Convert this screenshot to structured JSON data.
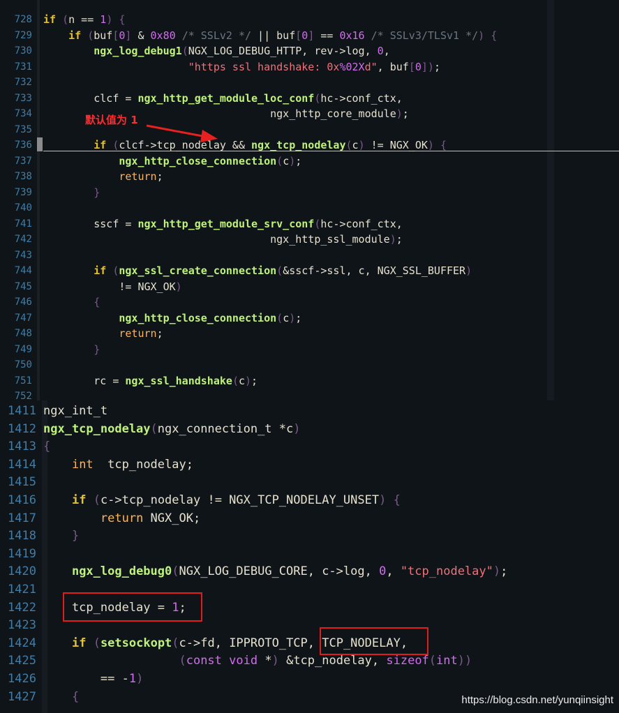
{
  "panel_top": {
    "lines": [
      {
        "n": "728",
        "segs": [
          [
            "t-kw",
            "if"
          ],
          [
            "t-pl",
            " "
          ],
          [
            "t-br",
            "("
          ],
          [
            "t-pl",
            "n == "
          ],
          [
            "t-num",
            "1"
          ],
          [
            "t-br",
            ")"
          ],
          [
            "t-pl",
            " "
          ],
          [
            "t-br",
            "{"
          ]
        ]
      },
      {
        "n": "729",
        "segs": [
          [
            "t-pl",
            "    "
          ],
          [
            "t-kw",
            "if"
          ],
          [
            "t-pl",
            " "
          ],
          [
            "t-br",
            "("
          ],
          [
            "t-pl",
            "buf"
          ],
          [
            "t-br",
            "["
          ],
          [
            "t-num",
            "0"
          ],
          [
            "t-br",
            "]"
          ],
          [
            "t-pl",
            " & "
          ],
          [
            "t-num",
            "0x80"
          ],
          [
            "t-pl",
            " "
          ],
          [
            "t-cm",
            "/* SSLv2 */"
          ],
          [
            "t-pl",
            " || buf"
          ],
          [
            "t-br",
            "["
          ],
          [
            "t-num",
            "0"
          ],
          [
            "t-br",
            "]"
          ],
          [
            "t-pl",
            " == "
          ],
          [
            "t-num",
            "0x16"
          ],
          [
            "t-pl",
            " "
          ],
          [
            "t-cm",
            "/* SSLv3/TLSv1 */"
          ],
          [
            "t-br",
            ")"
          ],
          [
            "t-pl",
            " "
          ],
          [
            "t-br",
            "{"
          ]
        ]
      },
      {
        "n": "730",
        "segs": [
          [
            "t-pl",
            "        "
          ],
          [
            "t-fn",
            "ngx_log_debug1"
          ],
          [
            "t-br",
            "("
          ],
          [
            "t-pl",
            "NGX_LOG_DEBUG_HTTP, rev->log, "
          ],
          [
            "t-num",
            "0"
          ],
          [
            "t-pl",
            ","
          ]
        ]
      },
      {
        "n": "731",
        "segs": [
          [
            "t-pl",
            "                       "
          ],
          [
            "t-str",
            "\"https ssl handshake: 0x"
          ],
          [
            "t-pr",
            "%02X"
          ],
          [
            "t-str",
            "d\""
          ],
          [
            "t-pl",
            ", buf"
          ],
          [
            "t-br",
            "["
          ],
          [
            "t-num",
            "0"
          ],
          [
            "t-br",
            "]"
          ],
          [
            "t-br",
            ")"
          ],
          [
            "t-pl",
            ";"
          ]
        ]
      },
      {
        "n": "732",
        "segs": []
      },
      {
        "n": "733",
        "segs": [
          [
            "t-pl",
            "        clcf = "
          ],
          [
            "t-fn",
            "ngx_http_get_module_loc_conf"
          ],
          [
            "t-br",
            "("
          ],
          [
            "t-pl",
            "hc->conf_ctx,"
          ]
        ]
      },
      {
        "n": "734",
        "segs": [
          [
            "t-pl",
            "                                    ngx_http_core_module"
          ],
          [
            "t-br",
            ")"
          ],
          [
            "t-pl",
            ";"
          ]
        ]
      },
      {
        "n": "735",
        "segs": []
      },
      {
        "n": "736",
        "segs": [
          [
            "t-pl",
            "        "
          ],
          [
            "t-kw",
            "if"
          ],
          [
            "t-pl",
            " "
          ],
          [
            "t-br",
            "("
          ],
          [
            "t-pl",
            "clcf->tcp_nodelay && "
          ],
          [
            "t-fn",
            "ngx_tcp_nodelay"
          ],
          [
            "t-br",
            "("
          ],
          [
            "t-pl",
            "c"
          ],
          [
            "t-br",
            ")"
          ],
          [
            "t-pl",
            " != NGX_OK"
          ],
          [
            "t-br",
            ")"
          ],
          [
            "t-pl",
            " "
          ],
          [
            "t-br",
            "{"
          ]
        ]
      },
      {
        "n": "737",
        "segs": [
          [
            "t-pl",
            "            "
          ],
          [
            "t-fn",
            "ngx_http_close_connection"
          ],
          [
            "t-br",
            "("
          ],
          [
            "t-pl",
            "c"
          ],
          [
            "t-br",
            ")"
          ],
          [
            "t-pl",
            ";"
          ]
        ]
      },
      {
        "n": "738",
        "segs": [
          [
            "t-pl",
            "            "
          ],
          [
            "t-ty",
            "return"
          ],
          [
            "t-pl",
            ";"
          ]
        ]
      },
      {
        "n": "739",
        "segs": [
          [
            "t-pl",
            "        "
          ],
          [
            "t-br",
            "}"
          ]
        ]
      },
      {
        "n": "740",
        "segs": []
      },
      {
        "n": "741",
        "segs": [
          [
            "t-pl",
            "        sscf = "
          ],
          [
            "t-fn",
            "ngx_http_get_module_srv_conf"
          ],
          [
            "t-br",
            "("
          ],
          [
            "t-pl",
            "hc->conf_ctx,"
          ]
        ]
      },
      {
        "n": "742",
        "segs": [
          [
            "t-pl",
            "                                    ngx_http_ssl_module"
          ],
          [
            "t-br",
            ")"
          ],
          [
            "t-pl",
            ";"
          ]
        ]
      },
      {
        "n": "743",
        "segs": []
      },
      {
        "n": "744",
        "segs": [
          [
            "t-pl",
            "        "
          ],
          [
            "t-kw",
            "if"
          ],
          [
            "t-pl",
            " "
          ],
          [
            "t-br",
            "("
          ],
          [
            "t-fn",
            "ngx_ssl_create_connection"
          ],
          [
            "t-br",
            "("
          ],
          [
            "t-pl",
            "&sscf->ssl, c, NGX_SSL_BUFFER"
          ],
          [
            "t-br",
            ")"
          ]
        ]
      },
      {
        "n": "745",
        "segs": [
          [
            "t-pl",
            "            != NGX_OK"
          ],
          [
            "t-br",
            ")"
          ]
        ]
      },
      {
        "n": "746",
        "segs": [
          [
            "t-pl",
            "        "
          ],
          [
            "t-br",
            "{"
          ]
        ]
      },
      {
        "n": "747",
        "segs": [
          [
            "t-pl",
            "            "
          ],
          [
            "t-fn",
            "ngx_http_close_connection"
          ],
          [
            "t-br",
            "("
          ],
          [
            "t-pl",
            "c"
          ],
          [
            "t-br",
            ")"
          ],
          [
            "t-pl",
            ";"
          ]
        ]
      },
      {
        "n": "748",
        "segs": [
          [
            "t-pl",
            "            "
          ],
          [
            "t-ty",
            "return"
          ],
          [
            "t-pl",
            ";"
          ]
        ]
      },
      {
        "n": "749",
        "segs": [
          [
            "t-pl",
            "        "
          ],
          [
            "t-br",
            "}"
          ]
        ]
      },
      {
        "n": "750",
        "segs": []
      },
      {
        "n": "751",
        "segs": [
          [
            "t-pl",
            "        rc = "
          ],
          [
            "t-fn",
            "ngx_ssl_handshake"
          ],
          [
            "t-br",
            "("
          ],
          [
            "t-pl",
            "c"
          ],
          [
            "t-br",
            ")"
          ],
          [
            "t-pl",
            ";"
          ]
        ]
      },
      {
        "n": "752",
        "segs": []
      }
    ],
    "annotation": "默认值为 1"
  },
  "panel_bottom": {
    "lines": [
      {
        "n": "1411",
        "segs": [
          [
            "t-pl",
            "ngx_int_t"
          ]
        ]
      },
      {
        "n": "1412",
        "segs": [
          [
            "t-fn",
            "ngx_tcp_nodelay"
          ],
          [
            "t-br",
            "("
          ],
          [
            "t-pl",
            "ngx_connection_t *c"
          ],
          [
            "t-br",
            ")"
          ]
        ]
      },
      {
        "n": "1413",
        "segs": [
          [
            "t-br",
            "{"
          ]
        ]
      },
      {
        "n": "1414",
        "segs": [
          [
            "t-pl",
            "    "
          ],
          [
            "t-ty",
            "int"
          ],
          [
            "t-pl",
            "  tcp_nodelay;"
          ]
        ]
      },
      {
        "n": "1415",
        "segs": []
      },
      {
        "n": "1416",
        "segs": [
          [
            "t-pl",
            "    "
          ],
          [
            "t-kw",
            "if"
          ],
          [
            "t-pl",
            " "
          ],
          [
            "t-br",
            "("
          ],
          [
            "t-pl",
            "c->tcp_nodelay != NGX_TCP_NODELAY_UNSET"
          ],
          [
            "t-br",
            ")"
          ],
          [
            "t-pl",
            " "
          ],
          [
            "t-br",
            "{"
          ]
        ]
      },
      {
        "n": "1417",
        "segs": [
          [
            "t-pl",
            "        "
          ],
          [
            "t-ty",
            "return"
          ],
          [
            "t-pl",
            " NGX_OK;"
          ]
        ]
      },
      {
        "n": "1418",
        "segs": [
          [
            "t-pl",
            "    "
          ],
          [
            "t-br",
            "}"
          ]
        ]
      },
      {
        "n": "1419",
        "segs": []
      },
      {
        "n": "1420",
        "segs": [
          [
            "t-pl",
            "    "
          ],
          [
            "t-fn",
            "ngx_log_debug0"
          ],
          [
            "t-br",
            "("
          ],
          [
            "t-pl",
            "NGX_LOG_DEBUG_CORE, c->log, "
          ],
          [
            "t-num",
            "0"
          ],
          [
            "t-pl",
            ", "
          ],
          [
            "t-str",
            "\"tcp_nodelay\""
          ],
          [
            "t-br",
            ")"
          ],
          [
            "t-pl",
            ";"
          ]
        ]
      },
      {
        "n": "1421",
        "segs": []
      },
      {
        "n": "1422",
        "segs": [
          [
            "t-pl",
            "    tcp_nodelay = "
          ],
          [
            "t-num",
            "1"
          ],
          [
            "t-pl",
            ";"
          ]
        ]
      },
      {
        "n": "1423",
        "segs": []
      },
      {
        "n": "1424",
        "segs": [
          [
            "t-pl",
            "    "
          ],
          [
            "t-kw",
            "if"
          ],
          [
            "t-pl",
            " "
          ],
          [
            "t-br",
            "("
          ],
          [
            "t-fn",
            "setsockopt"
          ],
          [
            "t-br",
            "("
          ],
          [
            "t-pl",
            "c->fd, IPPROTO_TCP, TCP_NODELAY,"
          ]
        ]
      },
      {
        "n": "1425",
        "segs": [
          [
            "t-pl",
            "                   "
          ],
          [
            "t-br",
            "("
          ],
          [
            "t-pr",
            "const"
          ],
          [
            "t-pl",
            " "
          ],
          [
            "t-pr",
            "void"
          ],
          [
            "t-pl",
            " *"
          ],
          [
            "t-br",
            ")"
          ],
          [
            "t-pl",
            " &tcp_nodelay, "
          ],
          [
            "t-pr",
            "sizeof"
          ],
          [
            "t-br",
            "("
          ],
          [
            "t-pr",
            "int"
          ],
          [
            "t-br",
            ")"
          ],
          [
            "t-br",
            ")"
          ]
        ]
      },
      {
        "n": "1426",
        "segs": [
          [
            "t-pl",
            "        == -"
          ],
          [
            "t-num",
            "1"
          ],
          [
            "t-br",
            ")"
          ]
        ]
      },
      {
        "n": "1427",
        "segs": [
          [
            "t-pl",
            "    "
          ],
          [
            "t-br",
            "{"
          ]
        ]
      }
    ]
  },
  "watermark": "https://blog.csdn.net/yunqiinsight"
}
